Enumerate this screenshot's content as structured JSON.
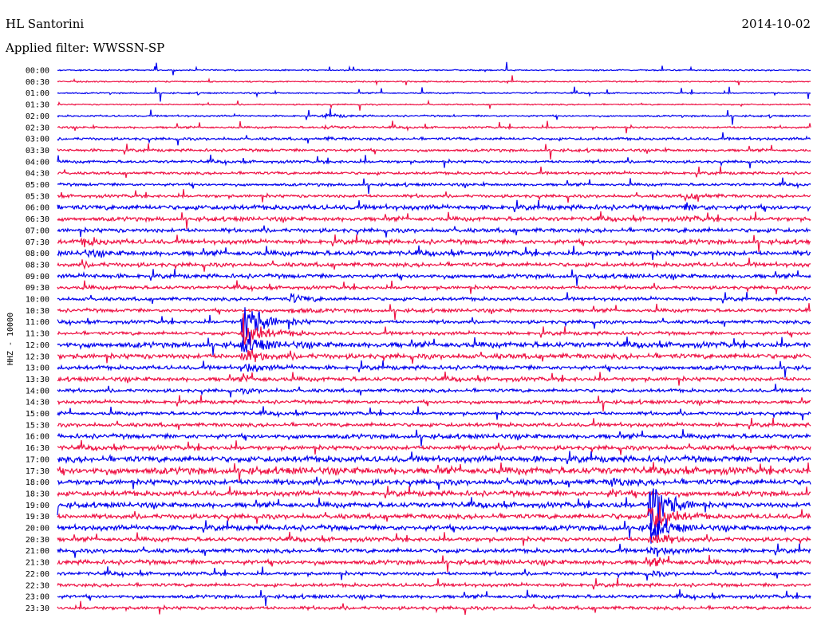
{
  "header": {
    "station": "HL Santorini",
    "date": "2014-10-02",
    "filter": "Applied filter: WWSSN-SP"
  },
  "chart_data": {
    "type": "line",
    "title": "HL Santorini",
    "ylabel": "HHZ - 10000",
    "x_axis_ticks": [],
    "rows": [
      "00:00",
      "00:30",
      "01:00",
      "01:30",
      "02:00",
      "02:30",
      "03:00",
      "03:30",
      "04:00",
      "04:30",
      "05:00",
      "05:30",
      "06:00",
      "06:30",
      "07:00",
      "07:30",
      "08:00",
      "08:30",
      "09:00",
      "09:30",
      "10:00",
      "10:30",
      "11:00",
      "11:30",
      "12:00",
      "12:30",
      "13:00",
      "13:30",
      "14:00",
      "14:30",
      "15:00",
      "15:30",
      "16:00",
      "16:30",
      "17:00",
      "17:30",
      "18:00",
      "18:30",
      "19:00",
      "19:30",
      "20:00",
      "20:30",
      "21:00",
      "21:30",
      "22:00",
      "22:30",
      "23:00",
      "23:30"
    ],
    "row_colors": [
      "#0000ee",
      "#ee1144"
    ],
    "noise_level": [
      0.4,
      0.4,
      0.4,
      0.4,
      0.5,
      0.6,
      0.8,
      0.8,
      0.8,
      0.8,
      0.8,
      0.9,
      1.4,
      1.2,
      1.2,
      1.3,
      1.4,
      1.2,
      1.2,
      1.0,
      1.0,
      1.0,
      1.0,
      1.0,
      1.6,
      1.5,
      1.2,
      1.2,
      1.0,
      1.0,
      1.0,
      1.1,
      1.3,
      1.3,
      1.8,
      2.0,
      1.6,
      1.5,
      1.5,
      1.4,
      1.5,
      1.2,
      1.2,
      1.3,
      1.0,
      1.0,
      1.0,
      1.0
    ],
    "events": [
      {
        "row": 4,
        "minute": 10.6,
        "amplitude": 6
      },
      {
        "row": 20,
        "minute": 9.3,
        "amplitude": 12
      },
      {
        "row": 22,
        "minute": 7.4,
        "amplitude": 80
      },
      {
        "row": 36,
        "minute": 22.0,
        "amplitude": 10
      },
      {
        "row": 38,
        "minute": 23.6,
        "amplitude": 100
      },
      {
        "row": 11,
        "minute": 25.0,
        "amplitude": 10
      },
      {
        "row": 15,
        "minute": 1.0,
        "amplitude": 10
      }
    ]
  }
}
